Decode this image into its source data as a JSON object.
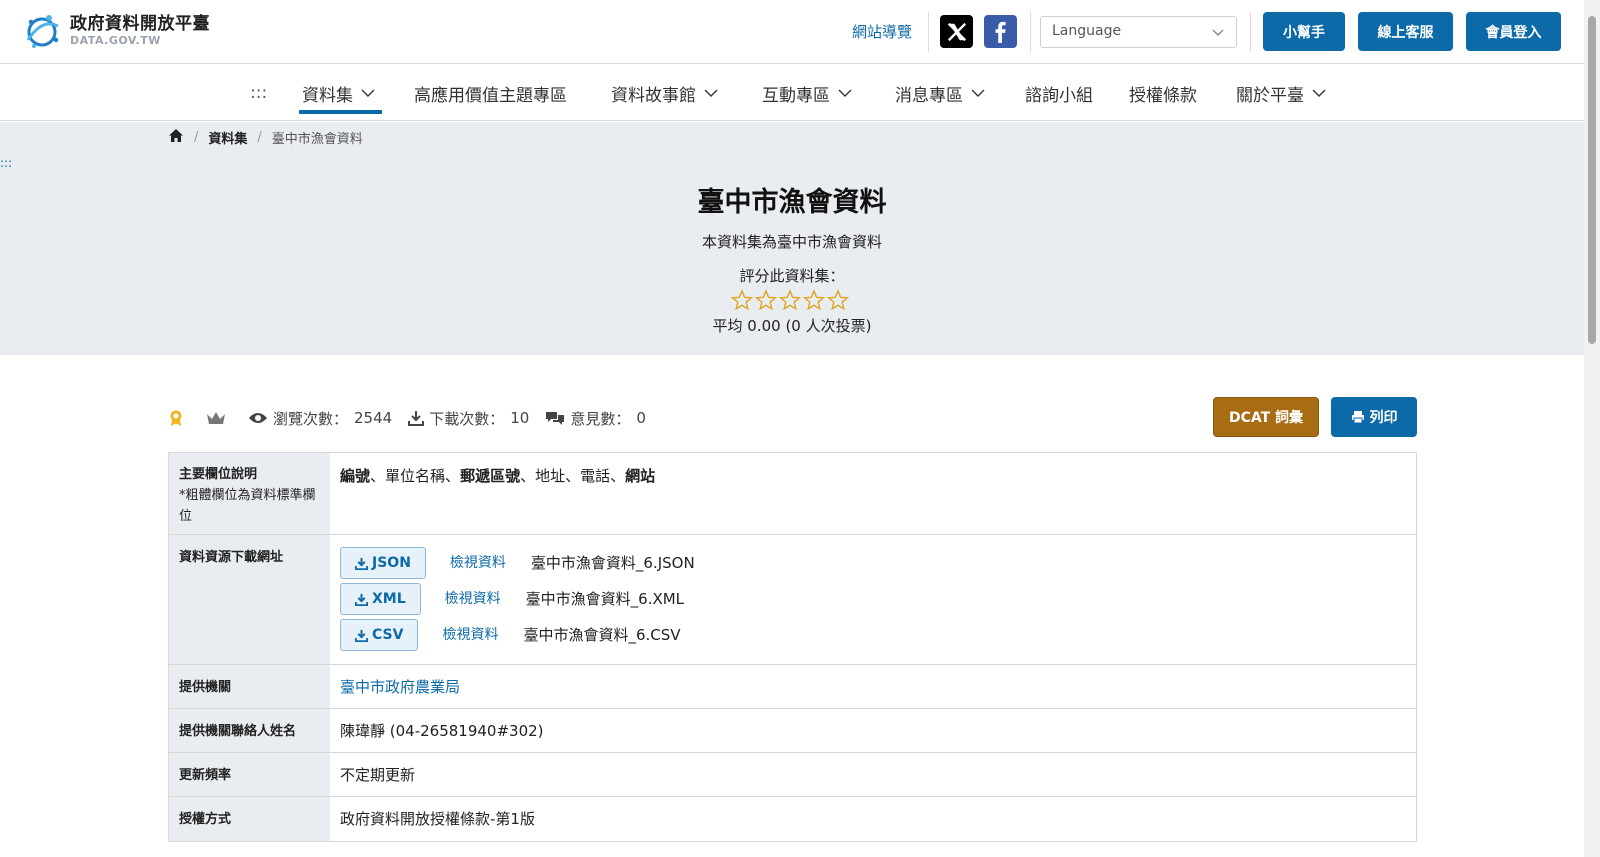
{
  "header": {
    "logo_title": "政府資料開放平臺",
    "logo_sub": "DATA.GOV.TW",
    "sitemap": "網站導覽",
    "language_placeholder": "Language",
    "buttons": {
      "helper": "小幫手",
      "support": "線上客服",
      "login": "會員登入"
    },
    "brand_color": "#0d6aa8"
  },
  "nav": {
    "skip": ":::",
    "items": [
      {
        "label": "資料集",
        "has_dropdown": true,
        "active": true
      },
      {
        "label": "高應用價值主題專區",
        "has_dropdown": false
      },
      {
        "label": "資料故事館",
        "has_dropdown": true
      },
      {
        "label": "互動專區",
        "has_dropdown": true
      },
      {
        "label": "消息專區",
        "has_dropdown": true
      },
      {
        "label": "諮詢小組",
        "has_dropdown": false
      },
      {
        "label": "授權條款",
        "has_dropdown": false
      },
      {
        "label": "關於平臺",
        "has_dropdown": true
      }
    ]
  },
  "breadcrumb": {
    "home_icon": "home-icon",
    "section": "資料集",
    "current": "臺中市漁會資料"
  },
  "hero": {
    "skip": ":::",
    "title": "臺中市漁會資料",
    "description": "本資料集為臺中市漁會資料",
    "rate_label": "評分此資料集：",
    "rating_stars": 0,
    "rating_max": 5,
    "average": "平均 0.00 (0 人次投票)"
  },
  "stats": {
    "views_label": "瀏覽次數：",
    "views": "2544",
    "downloads_label": "下載次數：",
    "downloads": "10",
    "comments_label": "意見數：",
    "comments": "0"
  },
  "actions": {
    "dcat": "DCAT 詞彙",
    "print": "列印"
  },
  "table": {
    "fields_label": "主要欄位說明",
    "fields_note": "*粗體欄位為資料標準欄位",
    "fields": [
      {
        "text": "編號",
        "bold": true
      },
      {
        "text": "、",
        "bold": false
      },
      {
        "text": "單位名稱",
        "bold": false
      },
      {
        "text": "、",
        "bold": false
      },
      {
        "text": "郵遞區號",
        "bold": true
      },
      {
        "text": "、",
        "bold": false
      },
      {
        "text": "地址",
        "bold": false
      },
      {
        "text": "、",
        "bold": false
      },
      {
        "text": "電話",
        "bold": false
      },
      {
        "text": "、",
        "bold": false
      },
      {
        "text": "網站",
        "bold": true
      }
    ],
    "resources_label": "資料資源下載網址",
    "resources": [
      {
        "format": "JSON",
        "view": "檢視資料",
        "filename": "臺中市漁會資料_6.JSON"
      },
      {
        "format": "XML",
        "view": "檢視資料",
        "filename": "臺中市漁會資料_6.XML"
      },
      {
        "format": "CSV",
        "view": "檢視資料",
        "filename": "臺中市漁會資料_6.CSV"
      }
    ],
    "agency_label": "提供機關",
    "agency": "臺中市政府農業局",
    "contact_label": "提供機關聯絡人姓名",
    "contact": "陳瑋靜 (04-26581940#302)",
    "frequency_label": "更新頻率",
    "frequency": "不定期更新",
    "license_label": "授權方式",
    "license": "政府資料開放授權條款-第1版"
  }
}
